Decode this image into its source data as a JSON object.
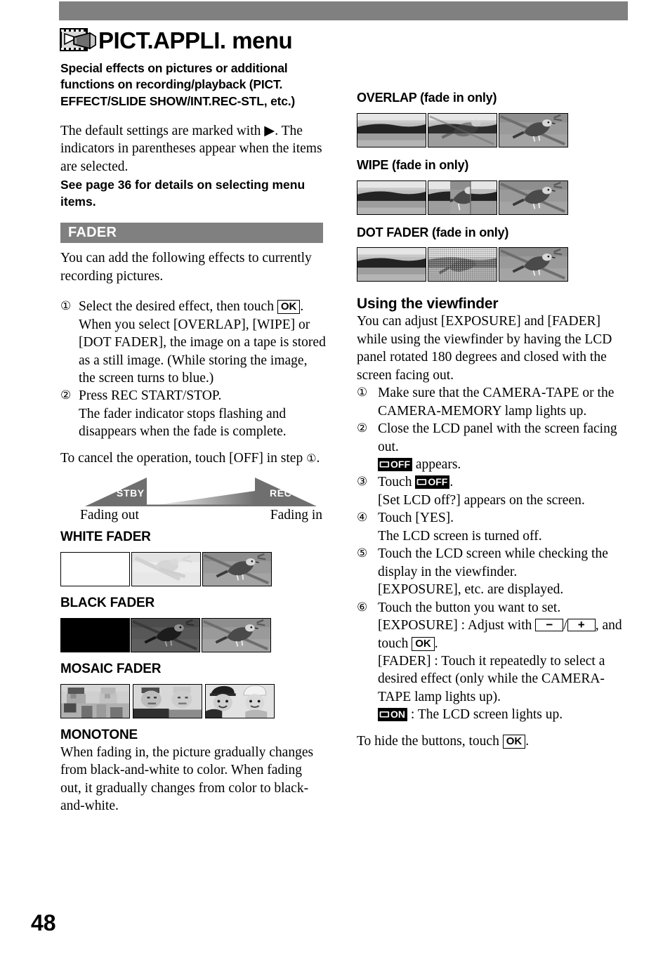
{
  "page": {
    "number": "48",
    "title": "PICT.APPLI. menu",
    "title_icon": "film-camcorder-icon",
    "header_band_color": "#808080"
  },
  "intro": {
    "subhead": "Special effects on pictures or additional functions on recording/playback (PICT. EFFECT/SLIDE SHOW/INT.REC-STL, etc.)",
    "paragraph": "The default settings are marked with ▶. The indicators in parentheses appear when the items are selected.",
    "bold_note": "See page 36 for details on selecting menu items."
  },
  "fader_section": {
    "bar_label": "FADER",
    "bar_color": "#808080",
    "intro": "You can add the following effects to currently recording pictures.",
    "steps": [
      {
        "num": "①",
        "text_before": "Select the desired effect, then touch ",
        "key": "OK",
        "text_after": ".",
        "sub": "When you select [OVERLAP], [WIPE] or [DOT FADER], the image on a tape is stored as a still image. (While storing the image, the screen turns to blue.)"
      },
      {
        "num": "②",
        "text_before": "Press REC START/STOP.",
        "key": "",
        "text_after": "",
        "sub": "The fader indicator stops flashing and disappears when the fade is complete."
      }
    ],
    "cancel_note_before": "To cancel the operation, touch [OFF] in step ",
    "cancel_note_step": "①",
    "cancel_note_after": ".",
    "diagram": {
      "left_label": "STBY",
      "right_label": "REC",
      "left_caption": "Fading out",
      "right_caption": "Fading in"
    },
    "effects": [
      {
        "label": "WHITE FADER",
        "name": "white-fader",
        "frames": [
          "white-blank",
          "bird-washed-out",
          "bird-normal"
        ]
      },
      {
        "label": "BLACK FADER",
        "name": "black-fader",
        "frames": [
          "black-blank",
          "bird-dark",
          "bird-normal"
        ]
      },
      {
        "label": "MOSAIC FADER",
        "name": "mosaic-fader",
        "frames": [
          "kids-mosaic-coarse",
          "kids-mosaic-fine",
          "kids-normal"
        ]
      }
    ],
    "monotone": {
      "label": "MONOTONE",
      "text": "When fading in, the picture gradually changes from black-and-white to color. When fading out, it gradually changes from color to black-and-white."
    }
  },
  "right_effects": [
    {
      "label": "OVERLAP (fade in only)",
      "name": "overlap",
      "frames": [
        "landscape",
        "landscape-bird-blend",
        "bird-normal"
      ]
    },
    {
      "label": "WIPE (fade in only)",
      "name": "wipe",
      "frames": [
        "landscape",
        "landscape-bird-wipe",
        "bird-normal"
      ]
    },
    {
      "label": "DOT FADER (fade in only)",
      "name": "dot-fader",
      "frames": [
        "landscape",
        "bird-dots",
        "bird-normal"
      ]
    }
  ],
  "viewfinder": {
    "heading": "Using the viewfinder",
    "intro": "You can adjust [EXPOSURE] and [FADER] while using the viewfinder by having the LCD panel rotated 180 degrees and closed with the screen facing out.",
    "steps": [
      {
        "num": "①",
        "text": "Make sure that the CAMERA-TAPE or the CAMERA-MEMORY lamp lights up.",
        "subs": []
      },
      {
        "num": "②",
        "text": "Close the LCD panel with the screen facing out.",
        "subs": []
      },
      {
        "num": "③",
        "text": "Touch ",
        "subs": []
      },
      {
        "num": "④",
        "text": "Touch [YES].",
        "subs": []
      },
      {
        "num": "⑤",
        "text": "Touch the LCD screen while checking the display in the viewfinder.",
        "subs": []
      },
      {
        "num": "⑥",
        "text": "Touch the button you want to set.",
        "subs": []
      }
    ],
    "step2_sub_after": " appears.",
    "lcd_off_label": "OFF",
    "lcd_on_label": "ON",
    "step3_sub": "[Set LCD off?] appears on the screen.",
    "step4_sub": "The LCD screen is turned off.",
    "step5_sub": "[EXPOSURE], etc. are displayed.",
    "step6_exposure_before": "[EXPOSURE] : Adjust with ",
    "minus_key": "−",
    "plus_key": "+",
    "step6_exposure_after": ", and touch ",
    "ok_key": "OK",
    "step6_exposure_end": ".",
    "step6_fader": "[FADER] : Touch it repeatedly to select a desired effect (only while the CAMERA-TAPE lamp lights up).",
    "step6_lcdon_after": " : The LCD screen lights up.",
    "hide_note_before": "To hide the buttons, touch ",
    "hide_note_key": "OK",
    "hide_note_after": "."
  }
}
